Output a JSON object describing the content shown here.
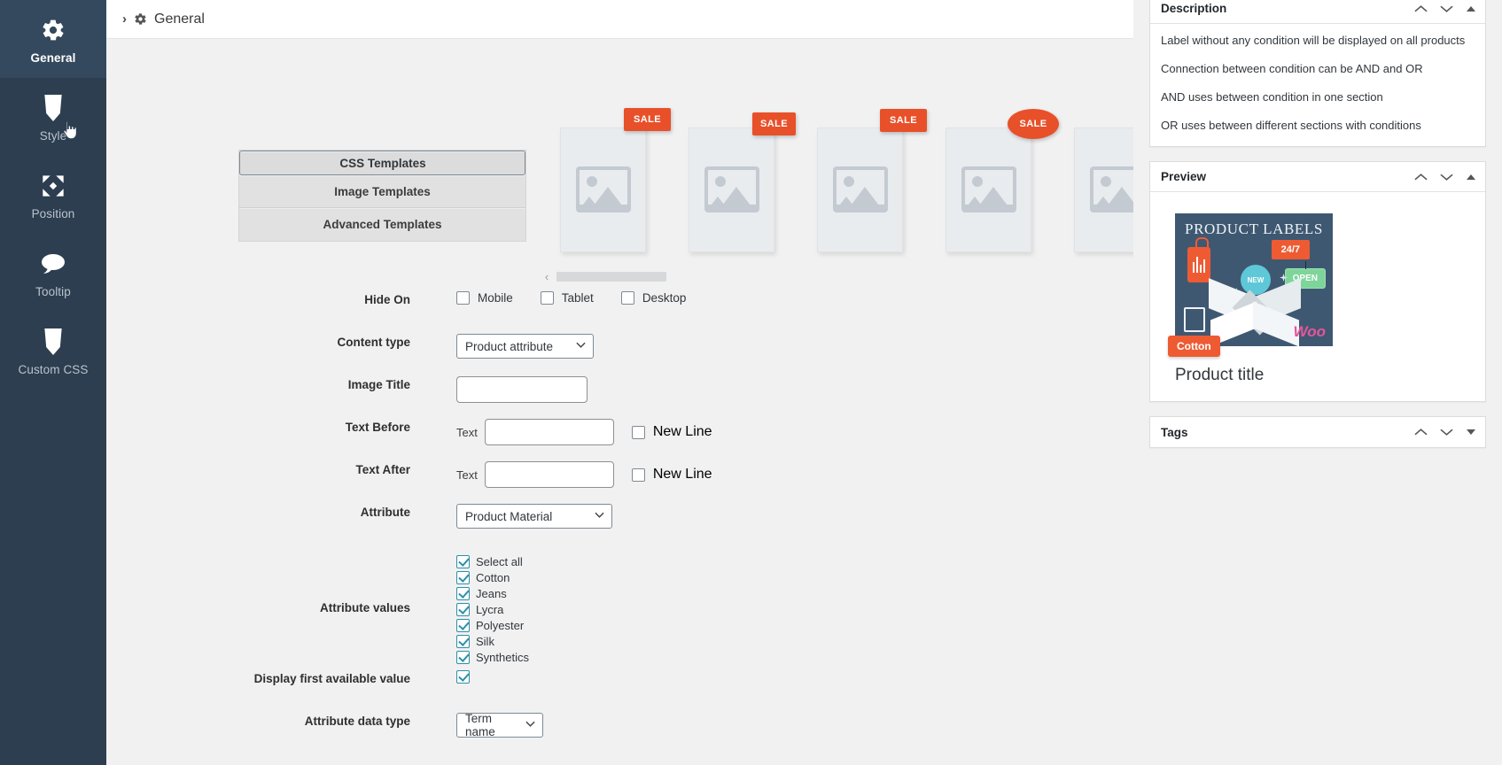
{
  "sidebar": {
    "items": [
      {
        "label": "General",
        "icon": "gear-icon",
        "active": true
      },
      {
        "label": "Style",
        "icon": "css3-icon",
        "active": false
      },
      {
        "label": "Position",
        "icon": "move-icon",
        "active": false
      },
      {
        "label": "Tooltip",
        "icon": "speech-bubble-icon",
        "active": false
      },
      {
        "label": "Custom CSS",
        "icon": "css3-icon",
        "active": false
      }
    ]
  },
  "topbar": {
    "chevron": "›",
    "icon": "gear-icon",
    "title": "General"
  },
  "templates": {
    "tabs": [
      {
        "label": "CSS Templates",
        "selected": true
      },
      {
        "label": "Image Templates",
        "selected": false
      },
      {
        "label": "Advanced Templates",
        "selected": false
      }
    ]
  },
  "carousel": {
    "badge_label": "SALE",
    "badge_color": "#e8502a",
    "cards": [
      {
        "shape": "rect"
      },
      {
        "shape": "rect"
      },
      {
        "shape": "rect"
      },
      {
        "shape": "ellipse"
      },
      {
        "shape": "circle"
      }
    ],
    "prev_arrow": "‹",
    "next_arrow": "›"
  },
  "form": {
    "hide_on": {
      "label": "Hide On",
      "options": [
        {
          "label": "Mobile",
          "checked": false
        },
        {
          "label": "Tablet",
          "checked": false
        },
        {
          "label": "Desktop",
          "checked": false
        }
      ]
    },
    "content_type": {
      "label": "Content type",
      "value": "Product attribute"
    },
    "image_title": {
      "label": "Image Title",
      "value": "",
      "placeholder": ""
    },
    "text_before": {
      "label": "Text Before",
      "prefix": "Text",
      "value": "",
      "newline_label": "New Line",
      "newline_checked": false
    },
    "text_after": {
      "label": "Text After",
      "prefix": "Text",
      "value": "",
      "newline_label": "New Line",
      "newline_checked": false
    },
    "attribute": {
      "label": "Attribute",
      "value": "Product Material"
    },
    "attribute_values": {
      "label": "Attribute values",
      "items": [
        {
          "label": "Select all",
          "checked": true
        },
        {
          "label": "Cotton",
          "checked": true
        },
        {
          "label": "Jeans",
          "checked": true
        },
        {
          "label": "Lycra",
          "checked": true
        },
        {
          "label": "Polyester",
          "checked": true
        },
        {
          "label": "Silk",
          "checked": true
        },
        {
          "label": "Synthetics",
          "checked": true
        }
      ]
    },
    "display_first": {
      "label": "Display first available value",
      "checked": true
    },
    "data_type": {
      "label": "Attribute data type",
      "value": "Term name"
    }
  },
  "right": {
    "description": {
      "title": "Description",
      "actions": [
        "collapse-up-icon",
        "collapse-down-icon",
        "toggle-icon"
      ],
      "paragraphs": [
        "Label without any condition will be displayed on all products",
        "Connection between condition can be AND and OR",
        "AND uses between condition in one section",
        "OR uses between different sections with conditions"
      ]
    },
    "preview": {
      "title": "Preview",
      "image": {
        "heading": "PRODUCT LABELS",
        "badge_247": "24/7",
        "badge_new": "NEW",
        "badge_open": "OPEN",
        "woo": "Woo"
      },
      "label_badge": "Cotton",
      "product_title": "Product title"
    },
    "tags": {
      "title": "Tags"
    }
  }
}
